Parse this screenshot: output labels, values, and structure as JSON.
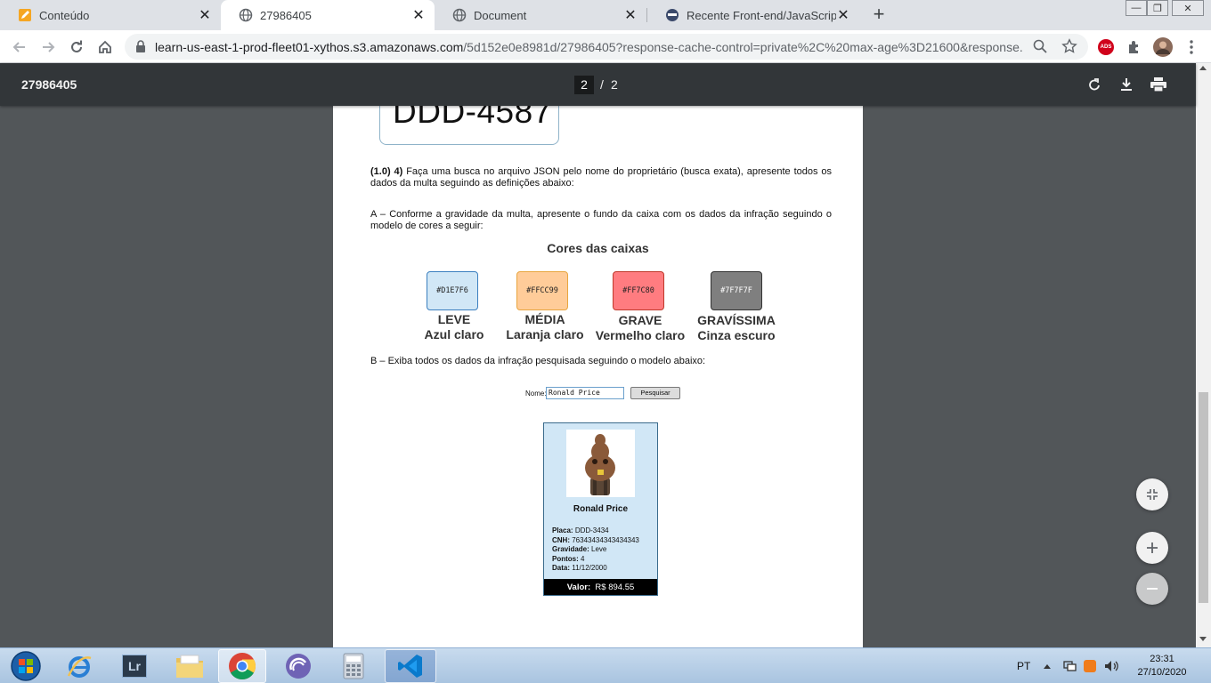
{
  "tabs": [
    {
      "title": "Conteúdo",
      "active": false
    },
    {
      "title": "27986405",
      "active": true
    },
    {
      "title": "Document",
      "active": false
    },
    {
      "title": "Recente Front-end/JavaScript tóp",
      "active": false
    }
  ],
  "toolbar": {
    "url_host": "learn-us-east-1-prod-fleet01-xythos.s3.amazonaws.com",
    "url_path": "/5d152e0e8981d/27986405?response-cache-control=private%2C%20max-age%3D21600&response...",
    "extension_badge": "ADS"
  },
  "pdf": {
    "doc_title": "27986405",
    "current_page": "2",
    "separator": "/",
    "total_pages": "2"
  },
  "page": {
    "plate_text": "DDD-4587",
    "q4_number": "(1.0) 4)",
    "q4_text": " Faça uma busca no arquivo JSON pelo nome do proprietário (busca exata), apresente todos os dados da multa seguindo as definições abaixo:",
    "partA": "A – Conforme a gravidade da multa, apresente o fundo da caixa com os dados da infração seguindo o modelo de cores a seguir:",
    "colors_title": "Cores das caixas",
    "swatches": [
      {
        "code": "#D1E7F6",
        "level": "LEVE",
        "name": "Azul claro",
        "fill": "#D1E7F6",
        "border": "#3b7fbf",
        "text": "#222222"
      },
      {
        "code": "#FFCC99",
        "level": "MÉDIA",
        "name": "Laranja claro",
        "fill": "#FFCC99",
        "border": "#e8a640",
        "text": "#222222"
      },
      {
        "code": "#FF7C80",
        "level": "GRAVE",
        "name": "Vermelho claro",
        "fill": "#FF7C80",
        "border": "#c0392b",
        "text": "#222222"
      },
      {
        "code": "#7F7F7F",
        "level": "GRAVÍSSIMA",
        "name": "Cinza escuro",
        "fill": "#7F7F7F",
        "border": "#333333",
        "text": "#ffffff"
      }
    ],
    "partB": "B – Exiba todos os dados da infração pesquisada seguindo o modelo abaixo:",
    "search": {
      "label": "Nome:",
      "value": "Ronald Price",
      "button": "Pesquisar"
    },
    "card": {
      "name": "Ronald Price",
      "placa_label": "Placa:",
      "placa": "DDD-3434",
      "cnh_label": "CNH:",
      "cnh": "76343434343434343",
      "gravidade_label": "Gravidade:",
      "gravidade": "Leve",
      "pontos_label": "Pontos:",
      "pontos": "4",
      "data_label": "Data:",
      "data": "11/12/2000",
      "valor_label": "Valor:",
      "valor": "R$ 894.55"
    }
  },
  "taskbar": {
    "lang": "PT",
    "time": "23:31",
    "date": "27/10/2020",
    "lightroom_label": "Lr"
  },
  "colors": {
    "tabstrip": "#dee1e6",
    "pdf_bar": "#323639",
    "pdf_bg": "#525659",
    "card_bg": "#D1E7F6"
  }
}
